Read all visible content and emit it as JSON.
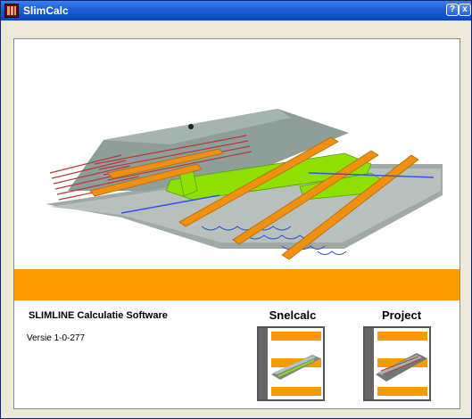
{
  "window": {
    "title": "SlimCalc",
    "help_label": "?",
    "close_label": "x"
  },
  "main": {
    "product_title": "SLIMLINE Calculatie Software",
    "version": "Versie 1-0-277",
    "buttons": {
      "snelcalc_label": "Snelcalc",
      "project_label": "Project"
    }
  },
  "colors": {
    "accent_orange": "#fd9a01",
    "titlebar_blue": "#0b47c4",
    "duct_green": "#8ee000"
  }
}
